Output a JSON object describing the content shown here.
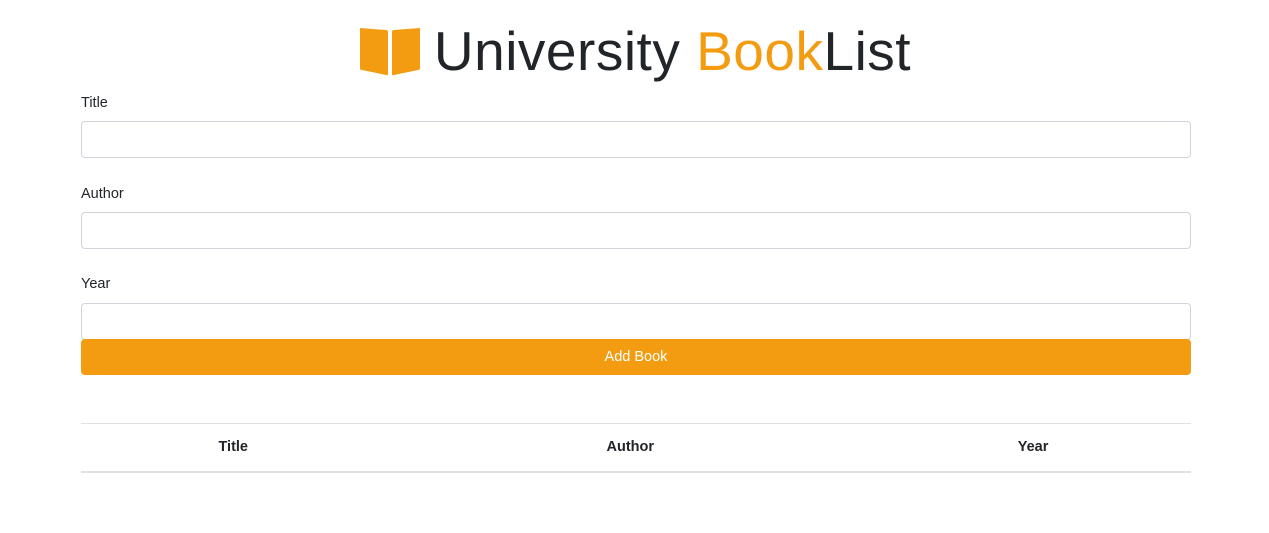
{
  "header": {
    "title_part1": "University ",
    "title_part2": "Book",
    "title_part3": "List",
    "icon": "open-book-icon",
    "accent_color": "#f39c12"
  },
  "form": {
    "title_label": "Title",
    "title_value": "",
    "author_label": "Author",
    "author_value": "",
    "year_label": "Year",
    "year_value": "",
    "submit_label": "Add Book"
  },
  "table": {
    "columns": [
      "Title",
      "Author",
      "Year"
    ],
    "rows": []
  }
}
